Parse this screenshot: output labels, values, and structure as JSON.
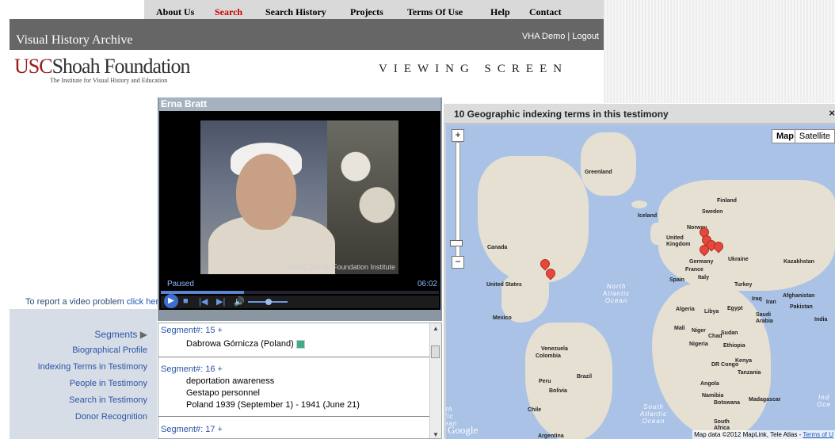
{
  "topnav": {
    "items": [
      "About Us",
      "Search",
      "Search History",
      "Projects",
      "Terms Of Use",
      "Help",
      "Contact"
    ],
    "active": "Search"
  },
  "header": {
    "title": "Visual History Archive",
    "user_links": "VHA Demo | Logout",
    "screen_title": "VIEWING SCREEN"
  },
  "logo": {
    "usc": "USC",
    "name": "Shoah Foundation",
    "subtitle": "The Institute for Visual History and Education"
  },
  "report": {
    "text": "To report a video problem",
    "link": "click here"
  },
  "sidebar": {
    "segments": "Segments",
    "items": [
      "Biographical Profile",
      "Indexing Terms in Testimony",
      "People in Testimony",
      "Search in Testimony",
      "Donor Recognition"
    ]
  },
  "video": {
    "name": "Erna Bratt",
    "status": "Paused",
    "time": "06:02",
    "watermark": "©USC Shoah Foundation Institute",
    "progress": 0.3
  },
  "segments": [
    {
      "header": "Segment#: 15 +",
      "terms": [
        "Dabrowa Górnicza (Poland)"
      ]
    },
    {
      "header": "Segment#: 16 +",
      "terms": [
        "deportation awareness",
        "Gestapo personnel",
        "Poland 1939 (September 1) - 1941 (June 21)"
      ]
    },
    {
      "header": "Segment#: 17 +",
      "terms": []
    }
  ],
  "map": {
    "title": "10 Geographic indexing terms in this testimony",
    "close": "×",
    "type_map": "Map",
    "type_satellite": "Satellite",
    "zoom_in": "+",
    "zoom_out": "−",
    "google": "Google",
    "credit": "Map data ©2012 MapLink, Tele Atlas - ",
    "credit_link": "Terms of U",
    "labels": {
      "greenland": "Greenland",
      "iceland": "Iceland",
      "finland": "Finland",
      "sweden": "Sweden",
      "norway": "Norway",
      "uk": "United Kingdom",
      "canada": "Canada",
      "germany": "Germany",
      "ukraine": "Ukraine",
      "kazakhstan": "Kazakhstan",
      "france": "France",
      "italy": "Italy",
      "spain": "Spain",
      "turkey": "Turkey",
      "us": "United States",
      "iraq": "Iraq",
      "iran": "Iran",
      "afghanistan": "Afghanistan",
      "pakistan": "Pakistan",
      "algeria": "Algeria",
      "libya": "Libya",
      "egypt": "Egypt",
      "saudi": "Saudi Arabia",
      "india": "India",
      "mexico": "Mexico",
      "mali": "Mali",
      "niger": "Niger",
      "chad": "Chad",
      "sudan": "Sudan",
      "nigeria": "Nigeria",
      "ethiopia": "Ethiopia",
      "venezuela": "Venezuela",
      "colombia": "Colombia",
      "drcongo": "DR Congo",
      "kenya": "Kenya",
      "tanzania": "Tanzania",
      "peru": "Peru",
      "brazil": "Brazil",
      "angola": "Angola",
      "bolivia": "Bolivia",
      "namibia": "Namibia",
      "botswana": "Botswana",
      "madagascar": "Madagascar",
      "chile": "Chile",
      "southafrica": "South Africa",
      "argentina": "Argentina"
    },
    "oceans": {
      "north_atlantic": "North Atlantic Ocean",
      "south_atlantic": "South Atlantic Ocean",
      "indian": "Ind Oce",
      "pacific": "th fic ean"
    }
  }
}
